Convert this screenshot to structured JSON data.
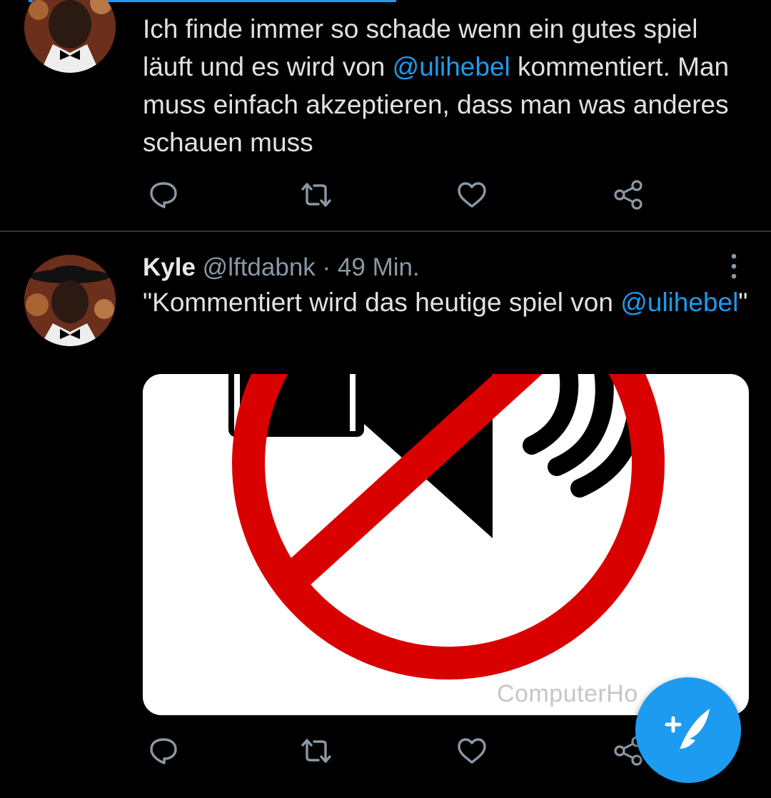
{
  "tweets": [
    {
      "text_parts": [
        "Ich finde immer so schade wenn ein gutes spiel läuft und es wird von ",
        "@ulihebel",
        " kommentiert. Man muss einfach akzeptieren, dass man was anderes schauen muss"
      ]
    },
    {
      "author_name": "Kyle",
      "handle": "@lftdabnk",
      "separator": "·",
      "timestamp": "49 Min.",
      "text_parts": [
        "\"Kommentiert wird das heutige spiel von ",
        "@ulihebel",
        "\""
      ],
      "media": {
        "watermark": "ComputerHo",
        "icon": "no-sound-sign"
      }
    }
  ],
  "icons": {
    "reply": "comment-icon",
    "retweet": "retweet-icon",
    "like": "heart-icon",
    "share": "share-icon",
    "more": "more-vertical-icon",
    "compose": "compose-tweet-icon"
  },
  "colors": {
    "background": "#000000",
    "accent": "#1d9bf0",
    "text": "#e1e1e1",
    "secondary_text": "#8b98a5",
    "divider": "#2f3336",
    "prohibition_red": "#d90000"
  }
}
